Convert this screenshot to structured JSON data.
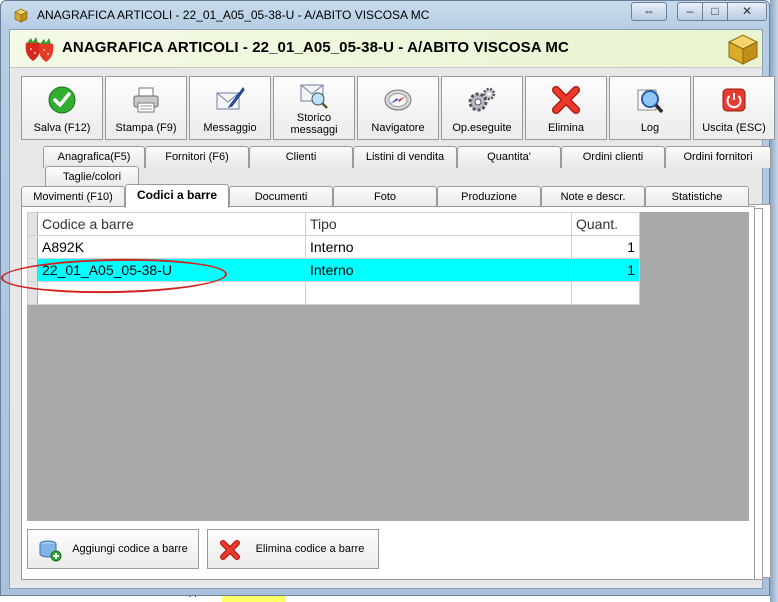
{
  "window": {
    "title": "ANAGRAFICA ARTICOLI - 22_01_A05_05-38-U - A/ABITO VISCOSA  MC",
    "header_title": "ANAGRAFICA ARTICOLI - 22_01_A05_05-38-U - A/ABITO VISCOSA  MC",
    "caption_extra": "⇔",
    "caption_min": "–",
    "caption_max": "□",
    "caption_close": "✕"
  },
  "toolbar": [
    {
      "label": "Salva (F12)",
      "icon": "check-icon"
    },
    {
      "label": "Stampa (F9)",
      "icon": "printer-icon"
    },
    {
      "label": "Messaggio",
      "icon": "envelope-pen-icon"
    },
    {
      "label": "Storico messaggi",
      "icon": "envelope-search-icon"
    },
    {
      "label": "Navigatore",
      "icon": "compass-icon"
    },
    {
      "label": "Op.eseguite",
      "icon": "gears-icon"
    },
    {
      "label": "Elimina",
      "icon": "red-x-icon"
    },
    {
      "label": "Log",
      "icon": "magnifier-icon"
    },
    {
      "label": "Uscita (ESC)",
      "icon": "power-icon"
    }
  ],
  "tabs_row1": [
    "Anagrafica(F5)",
    "Fornitori (F6)",
    "Clienti",
    "Listini di vendita",
    "Quantita'",
    "Ordini clienti",
    "Ordini fornitori"
  ],
  "tabs_row2": [
    "Taglie/colori"
  ],
  "tabs_row3": [
    "Movimenti (F10)",
    "Codici a barre",
    "Documenti",
    "Foto",
    "Produzione",
    "Note e descr.",
    "Statistiche"
  ],
  "active_tab": "Codici a barre",
  "grid": {
    "columns": [
      "Codice a barre",
      "Tipo",
      "Quant."
    ],
    "rows": [
      {
        "code": "A892K",
        "type": "Interno",
        "qty": "1"
      },
      {
        "code": "22_01_A05_05-38-U",
        "type": "Interno",
        "qty": "1"
      },
      {
        "code": "",
        "type": "",
        "qty": ""
      }
    ],
    "selected_row": 1
  },
  "buttons": {
    "add_label": "Aggiungi codice a barre",
    "delete_label": "Elimina codice a barre"
  },
  "background": {
    "cell_value": "44"
  },
  "colors": {
    "selection": "#00ffff",
    "annotation": "#d3201b"
  }
}
